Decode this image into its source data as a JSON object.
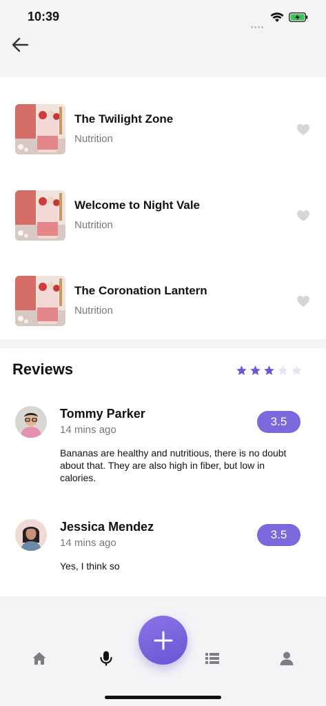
{
  "status": {
    "time": "10:39"
  },
  "list": {
    "items": [
      {
        "title": "The Twilight Zone",
        "category": "Nutrition"
      },
      {
        "title": "Welcome to Night Vale",
        "category": "Nutrition"
      },
      {
        "title": "The Coronation Lantern",
        "category": "Nutrition"
      }
    ]
  },
  "reviews": {
    "title": "Reviews",
    "rating_stars": 3,
    "rating_max": 5,
    "items": [
      {
        "name": "Tommy Parker",
        "time": "14 mins ago",
        "score": "3.5",
        "text": "Bananas are healthy and nutritious, there is no doubt about that. They are also high in fiber, but low in calories."
      },
      {
        "name": "Jessica Mendez",
        "time": "14 mins ago",
        "score": "3.5",
        "text": "Yes, I think so"
      }
    ]
  },
  "tabbar": {
    "tabs": [
      "home-icon",
      "microphone-icon",
      "list-icon",
      "profile-icon"
    ],
    "fab_icon": "plus-icon"
  },
  "colors": {
    "accent": "#7b68dd",
    "background": "#f4f4f7",
    "star_active": "#6b5ad6",
    "star_inactive": "#e6e3f7"
  }
}
